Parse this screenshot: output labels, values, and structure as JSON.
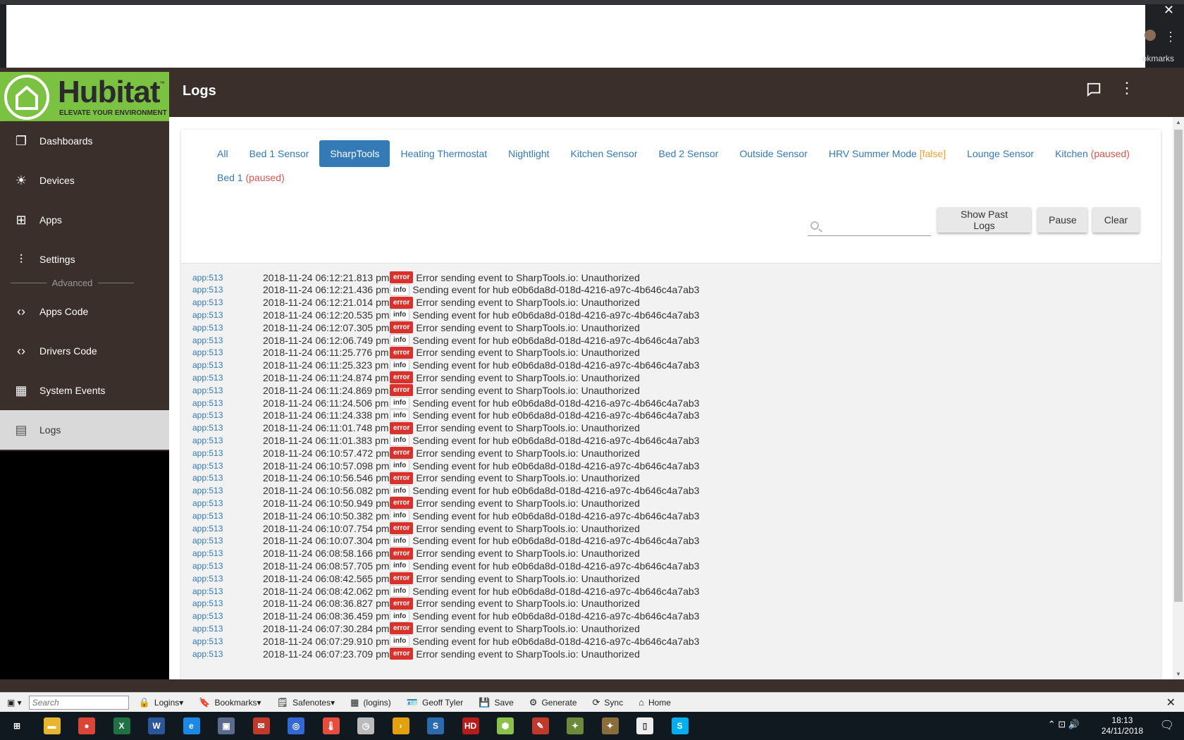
{
  "browser": {
    "close_glyph": "✕",
    "kebab_glyph": "⋮",
    "bookmarks_partial": "okmarks"
  },
  "header": {
    "title": "Logs",
    "kebab_glyph": "⋮"
  },
  "logo": {
    "name": "Hubitat",
    "tagline": "ELEVATE YOUR ENVIRONMENT",
    "tm": "™"
  },
  "sidebar": {
    "items": [
      {
        "label": "Dashboards",
        "icon": "dashboards-icon",
        "glyph": "❐"
      },
      {
        "label": "Devices",
        "icon": "bulb-icon",
        "glyph": "☀"
      },
      {
        "label": "Apps",
        "icon": "apps-icon",
        "glyph": "⊞"
      },
      {
        "label": "Settings",
        "icon": "sliders-icon",
        "glyph": "⫶"
      },
      {
        "label": "Apps Code",
        "icon": "code-icon",
        "glyph": "‹›"
      },
      {
        "label": "Drivers Code",
        "icon": "code-icon",
        "glyph": "‹›"
      },
      {
        "label": "System Events",
        "icon": "calendar-icon",
        "glyph": "▦"
      },
      {
        "label": "Logs",
        "icon": "document-icon",
        "glyph": "▤"
      }
    ],
    "advanced_label": "Advanced",
    "active": "Logs"
  },
  "filters": {
    "row1": [
      {
        "label": "All",
        "suffix": "",
        "suffix_type": ""
      },
      {
        "label": "Bed 1 Sensor",
        "suffix": "",
        "suffix_type": ""
      },
      {
        "label": "SharpTools",
        "suffix": "",
        "suffix_type": "",
        "active": true
      },
      {
        "label": "Heating Thermostat",
        "suffix": "",
        "suffix_type": ""
      },
      {
        "label": "Nightlight",
        "suffix": "",
        "suffix_type": ""
      },
      {
        "label": "Kitchen Sensor",
        "suffix": "",
        "suffix_type": ""
      },
      {
        "label": "Bed 2 Sensor",
        "suffix": "",
        "suffix_type": ""
      },
      {
        "label": "Outside Sensor",
        "suffix": "",
        "suffix_type": ""
      },
      {
        "label": "HRV Summer Mode",
        "suffix": "[false]",
        "suffix_type": "false"
      },
      {
        "label": "Lounge Sensor",
        "suffix": "",
        "suffix_type": ""
      },
      {
        "label": "Kitchen",
        "suffix": "(paused)",
        "suffix_type": "paused"
      }
    ],
    "row2": [
      {
        "label": "Bed 1",
        "suffix": "(paused)",
        "suffix_type": "paused"
      }
    ]
  },
  "search": {
    "placeholder": "",
    "value": ""
  },
  "buttons": {
    "show_past_logs": "Show Past Logs",
    "pause": "Pause",
    "clear": "Clear"
  },
  "logs": [
    {
      "src": "app:513",
      "time": "2018-11-24 06:12:21.813 pm",
      "level": "error",
      "msg": "Error sending event to SharpTools.io: Unauthorized"
    },
    {
      "src": "app:513",
      "time": "2018-11-24 06:12:21.436 pm",
      "level": "info",
      "msg": "Sending event for hub e0b6da8d-018d-4216-a97c-4b646c4a7ab3"
    },
    {
      "src": "app:513",
      "time": "2018-11-24 06:12:21.014 pm",
      "level": "error",
      "msg": "Error sending event to SharpTools.io: Unauthorized"
    },
    {
      "src": "app:513",
      "time": "2018-11-24 06:12:20.535 pm",
      "level": "info",
      "msg": "Sending event for hub e0b6da8d-018d-4216-a97c-4b646c4a7ab3"
    },
    {
      "src": "app:513",
      "time": "2018-11-24 06:12:07.305 pm",
      "level": "error",
      "msg": "Error sending event to SharpTools.io: Unauthorized"
    },
    {
      "src": "app:513",
      "time": "2018-11-24 06:12:06.749 pm",
      "level": "info",
      "msg": "Sending event for hub e0b6da8d-018d-4216-a97c-4b646c4a7ab3"
    },
    {
      "src": "app:513",
      "time": "2018-11-24 06:11:25.776 pm",
      "level": "error",
      "msg": "Error sending event to SharpTools.io: Unauthorized"
    },
    {
      "src": "app:513",
      "time": "2018-11-24 06:11:25.323 pm",
      "level": "info",
      "msg": "Sending event for hub e0b6da8d-018d-4216-a97c-4b646c4a7ab3"
    },
    {
      "src": "app:513",
      "time": "2018-11-24 06:11:24.874 pm",
      "level": "error",
      "msg": "Error sending event to SharpTools.io: Unauthorized"
    },
    {
      "src": "app:513",
      "time": "2018-11-24 06:11:24.869 pm",
      "level": "error",
      "msg": "Error sending event to SharpTools.io: Unauthorized"
    },
    {
      "src": "app:513",
      "time": "2018-11-24 06:11:24.506 pm",
      "level": "info",
      "msg": "Sending event for hub e0b6da8d-018d-4216-a97c-4b646c4a7ab3"
    },
    {
      "src": "app:513",
      "time": "2018-11-24 06:11:24.338 pm",
      "level": "info",
      "msg": "Sending event for hub e0b6da8d-018d-4216-a97c-4b646c4a7ab3"
    },
    {
      "src": "app:513",
      "time": "2018-11-24 06:11:01.748 pm",
      "level": "error",
      "msg": "Error sending event to SharpTools.io: Unauthorized"
    },
    {
      "src": "app:513",
      "time": "2018-11-24 06:11:01.383 pm",
      "level": "info",
      "msg": "Sending event for hub e0b6da8d-018d-4216-a97c-4b646c4a7ab3"
    },
    {
      "src": "app:513",
      "time": "2018-11-24 06:10:57.472 pm",
      "level": "error",
      "msg": "Error sending event to SharpTools.io: Unauthorized"
    },
    {
      "src": "app:513",
      "time": "2018-11-24 06:10:57.098 pm",
      "level": "info",
      "msg": "Sending event for hub e0b6da8d-018d-4216-a97c-4b646c4a7ab3"
    },
    {
      "src": "app:513",
      "time": "2018-11-24 06:10:56.546 pm",
      "level": "error",
      "msg": "Error sending event to SharpTools.io: Unauthorized"
    },
    {
      "src": "app:513",
      "time": "2018-11-24 06:10:56.082 pm",
      "level": "info",
      "msg": "Sending event for hub e0b6da8d-018d-4216-a97c-4b646c4a7ab3"
    },
    {
      "src": "app:513",
      "time": "2018-11-24 06:10:50.949 pm",
      "level": "error",
      "msg": "Error sending event to SharpTools.io: Unauthorized"
    },
    {
      "src": "app:513",
      "time": "2018-11-24 06:10:50.382 pm",
      "level": "info",
      "msg": "Sending event for hub e0b6da8d-018d-4216-a97c-4b646c4a7ab3"
    },
    {
      "src": "app:513",
      "time": "2018-11-24 06:10:07.754 pm",
      "level": "error",
      "msg": "Error sending event to SharpTools.io: Unauthorized"
    },
    {
      "src": "app:513",
      "time": "2018-11-24 06:10:07.304 pm",
      "level": "info",
      "msg": "Sending event for hub e0b6da8d-018d-4216-a97c-4b646c4a7ab3"
    },
    {
      "src": "app:513",
      "time": "2018-11-24 06:08:58.166 pm",
      "level": "error",
      "msg": "Error sending event to SharpTools.io: Unauthorized"
    },
    {
      "src": "app:513",
      "time": "2018-11-24 06:08:57.705 pm",
      "level": "info",
      "msg": "Sending event for hub e0b6da8d-018d-4216-a97c-4b646c4a7ab3"
    },
    {
      "src": "app:513",
      "time": "2018-11-24 06:08:42.565 pm",
      "level": "error",
      "msg": "Error sending event to SharpTools.io: Unauthorized"
    },
    {
      "src": "app:513",
      "time": "2018-11-24 06:08:42.062 pm",
      "level": "info",
      "msg": "Sending event for hub e0b6da8d-018d-4216-a97c-4b646c4a7ab3"
    },
    {
      "src": "app:513",
      "time": "2018-11-24 06:08:36.827 pm",
      "level": "error",
      "msg": "Error sending event to SharpTools.io: Unauthorized"
    },
    {
      "src": "app:513",
      "time": "2018-11-24 06:08:36.459 pm",
      "level": "info",
      "msg": "Sending event for hub e0b6da8d-018d-4216-a97c-4b646c4a7ab3"
    },
    {
      "src": "app:513",
      "time": "2018-11-24 06:07:30.284 pm",
      "level": "error",
      "msg": "Error sending event to SharpTools.io: Unauthorized"
    },
    {
      "src": "app:513",
      "time": "2018-11-24 06:07:29.910 pm",
      "level": "info",
      "msg": "Sending event for hub e0b6da8d-018d-4216-a97c-4b646c4a7ab3"
    },
    {
      "src": "app:513",
      "time": "2018-11-24 06:07:23.709 pm",
      "level": "error",
      "msg": "Error sending event to SharpTools.io: Unauthorized"
    }
  ],
  "lastpass": {
    "search_placeholder": "Search",
    "items": [
      {
        "label": "Logins",
        "icon": "lock-icon",
        "glyph": "🔒",
        "dropdown": true
      },
      {
        "label": "Bookmarks",
        "icon": "bookmark-icon",
        "glyph": "🔖",
        "dropdown": true
      },
      {
        "label": "Safenotes",
        "icon": "note-icon",
        "glyph": "🗒",
        "dropdown": true
      },
      {
        "label": "(logins)",
        "icon": "grid-icon",
        "glyph": "▦",
        "dropdown": false
      },
      {
        "label": "Geoff Tyler",
        "icon": "card-icon",
        "glyph": "🪪",
        "dropdown": false
      },
      {
        "label": "Save",
        "icon": "save-icon",
        "glyph": "💾",
        "dropdown": false
      },
      {
        "label": "Generate",
        "icon": "generate-icon",
        "glyph": "⚙",
        "dropdown": false
      },
      {
        "label": "Sync",
        "icon": "sync-icon",
        "glyph": "⟳",
        "dropdown": false
      },
      {
        "label": "Home",
        "icon": "home-icon",
        "glyph": "⌂",
        "dropdown": false
      }
    ],
    "close_glyph": "✕"
  },
  "taskbar": {
    "time": "18:13",
    "date": "24/11/2018",
    "icons": [
      {
        "name": "windows-start-icon",
        "glyph": "⊞",
        "color": "#101820"
      },
      {
        "name": "file-explorer-icon",
        "glyph": "▬",
        "color": "#e8b52f"
      },
      {
        "name": "chrome-icon",
        "glyph": "●",
        "color": "#db4437"
      },
      {
        "name": "excel-icon",
        "glyph": "X",
        "color": "#1f7244"
      },
      {
        "name": "word-icon",
        "glyph": "W",
        "color": "#2b579a"
      },
      {
        "name": "edge-icon",
        "glyph": "e",
        "color": "#1e88e5"
      },
      {
        "name": "network-app-icon",
        "glyph": "▣",
        "color": "#5a6b8c"
      },
      {
        "name": "mail-icon",
        "glyph": "✉",
        "color": "#c0392b"
      },
      {
        "name": "browser-globe-icon",
        "glyph": "◎",
        "color": "#3367d6"
      },
      {
        "name": "thermometer-icon",
        "glyph": "🌡",
        "color": "#e74c3c"
      },
      {
        "name": "clock-app-icon",
        "glyph": "◷",
        "color": "#bbbbbb"
      },
      {
        "name": "plex-icon",
        "glyph": "›",
        "color": "#e5a00d"
      },
      {
        "name": "sonia-icon",
        "glyph": "S",
        "color": "#2a6bb0"
      },
      {
        "name": "hd-app-icon",
        "glyph": "HD",
        "color": "#b71c1c"
      },
      {
        "name": "hubitat-hex-icon",
        "glyph": "⬢",
        "color": "#8bc34a"
      },
      {
        "name": "tools-app-icon",
        "glyph": "✎",
        "color": "#c0392b"
      },
      {
        "name": "satellite-icon",
        "glyph": "✦",
        "color": "#6d8a3a"
      },
      {
        "name": "satellite2-icon",
        "glyph": "✦",
        "color": "#8a6d3a"
      },
      {
        "name": "blank-doc-icon",
        "glyph": "▯",
        "color": "#eeeeee"
      },
      {
        "name": "skype-icon",
        "glyph": "S",
        "color": "#00aff0"
      }
    ],
    "tray_glyphs": "⌃ ⊡ 🔊",
    "notify_glyph": "🗨"
  },
  "colors": {
    "brand_green": "#7cc242",
    "header_brown": "#3b2f2b",
    "link_blue": "#337ab7",
    "error_red": "#d9312b",
    "false_orange": "#f0a030",
    "paused_red": "#d9534f"
  }
}
